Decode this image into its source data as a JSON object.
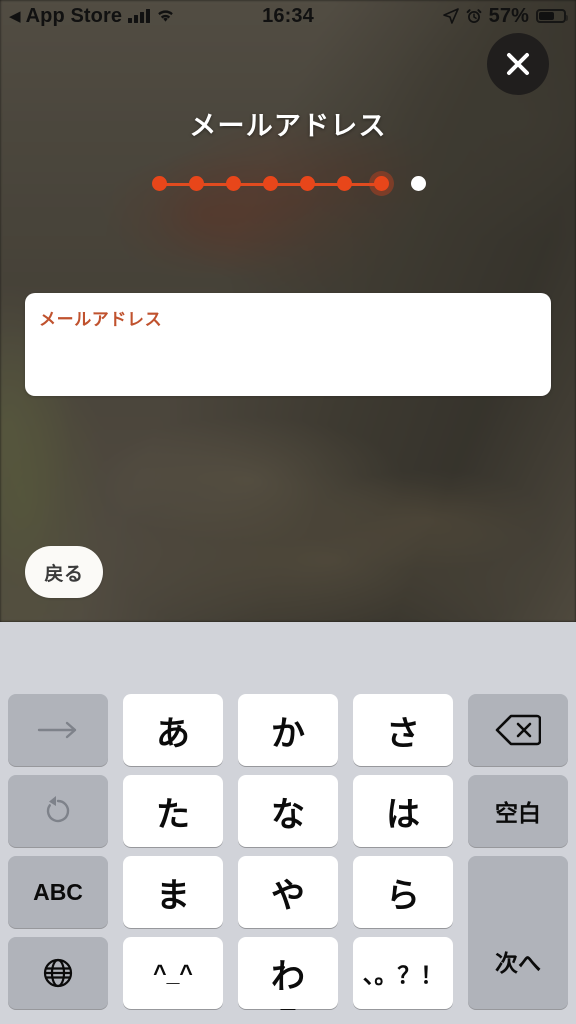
{
  "status_bar": {
    "back_app_label": "App Store",
    "back_arrow": "◀",
    "time": "16:34",
    "battery_percent": "57%",
    "icons": [
      "signal-bars",
      "wifi",
      "location-arrow",
      "alarm-clock",
      "battery"
    ]
  },
  "overlay": {
    "close_label": "✕",
    "title": "メールアドレス",
    "back_button_label": "戻る"
  },
  "progress": {
    "total_steps": 8,
    "current_step": 7,
    "completed_color": "#e8461a",
    "upcoming_color": "#ffffff"
  },
  "form": {
    "field_label": "メールアドレス",
    "field_value": "",
    "field_placeholder": "",
    "label_color": "#c0522e"
  },
  "keyboard": {
    "type": "japanese-kana-12key",
    "rows": [
      [
        {
          "label": "→",
          "icon": "arrow-right-icon",
          "style": "dark",
          "kind": "fn",
          "dim": true,
          "name": "key-cursor-right"
        },
        {
          "label": "あ",
          "style": "light",
          "kind": "kana",
          "name": "key-a"
        },
        {
          "label": "か",
          "style": "light",
          "kind": "kana",
          "name": "key-ka"
        },
        {
          "label": "さ",
          "style": "light",
          "kind": "kana",
          "name": "key-sa"
        },
        {
          "label": "",
          "icon": "backspace-icon",
          "style": "dark",
          "kind": "fn",
          "name": "key-backspace"
        }
      ],
      [
        {
          "label": "↺",
          "icon": "undo-icon",
          "style": "dark",
          "kind": "fn",
          "dim": true,
          "name": "key-undo"
        },
        {
          "label": "た",
          "style": "light",
          "kind": "kana",
          "name": "key-ta"
        },
        {
          "label": "な",
          "style": "light",
          "kind": "kana",
          "name": "key-na"
        },
        {
          "label": "は",
          "style": "light",
          "kind": "kana",
          "name": "key-ha"
        },
        {
          "label": "空白",
          "style": "dark",
          "kind": "small",
          "name": "key-space"
        }
      ],
      [
        {
          "label": "ABC",
          "style": "dark",
          "kind": "small",
          "name": "key-abc"
        },
        {
          "label": "ま",
          "style": "light",
          "kind": "kana",
          "name": "key-ma"
        },
        {
          "label": "や",
          "style": "light",
          "kind": "kana",
          "name": "key-ya"
        },
        {
          "label": "ら",
          "style": "light",
          "kind": "kana",
          "name": "key-ra"
        },
        {
          "label": "次へ",
          "style": "dark",
          "kind": "small",
          "tall": true,
          "name": "key-next"
        }
      ],
      [
        {
          "label": "",
          "icon": "globe-icon",
          "style": "dark",
          "kind": "fn",
          "name": "key-globe"
        },
        {
          "label": "^_^",
          "style": "light",
          "kind": "small",
          "name": "key-emoticon"
        },
        {
          "label": "わ",
          "sublabel": "_",
          "style": "light",
          "kind": "kana",
          "name": "key-wa"
        },
        {
          "label": "、。？！",
          "style": "light",
          "kind": "small",
          "name": "key-punctuation"
        }
      ]
    ]
  }
}
